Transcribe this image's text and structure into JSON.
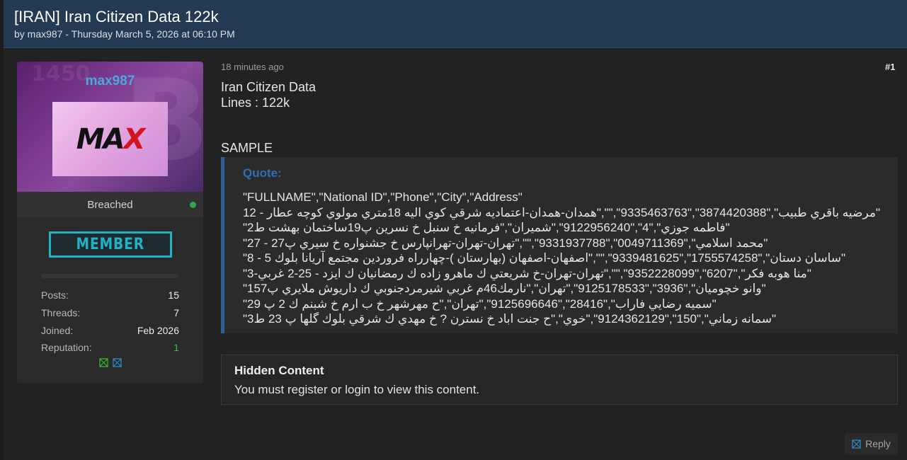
{
  "thread": {
    "title": "[IRAN] Iran Citizen Data 122k",
    "meta": "by max987 - Thursday March 5, 2026 at 06:10 PM"
  },
  "user": {
    "username": "max987",
    "avatar_text": "MA",
    "avatar_text_x": "X",
    "role": "Breached",
    "badge": "MEMBER",
    "stats": [
      {
        "label": "Posts:",
        "value": "15"
      },
      {
        "label": "Threads:",
        "value": "7"
      },
      {
        "label": "Joined:",
        "value": "Feb 2026"
      },
      {
        "label": "Reputation:",
        "value": "1"
      }
    ]
  },
  "post": {
    "time": "18 minutes ago",
    "number": "#1",
    "lines": [
      "Iran Citizen Data",
      "Lines : 122k",
      "SAMPLE"
    ],
    "quote_label": "Quote:",
    "quote_header": "\"FULLNAME\",\"National ID\",\"Phone\",\"City\",\"Address\"",
    "quote_rows": [
      "\"مرضيه باقري طبيب\",\"3874420388\",\"9335463763\",\"\",\"همدان-همدان-اعتماديه شرقي كوي اليه 18متري مولوي كوچه عطار - 12\"",
      "\"فاطمه جوزي\",\"4\",\"9122956240\",\"شميران\",\"فرمانيه خ سنبل خ نسرين پ19ساختمان بهشت ط2\"",
      "\"محمد اسلامي\",\"0049711369\",\"9331937788\",\"\",\"تهران-تهران-تهرانپارس خ جشنواره خ سيري پ27 - 27\"",
      "\"ساسان دستان\",\"1755574258\",\"9339481625\",\"\",\"اصفهان-اصفهان (بهارستان )-چهارراه فروردين مجتمع آريانا بلوك 5 - 8\"",
      "\"منا هوبه فكر\",\"6207\",\"9352228099\",\"\",\"تهران-تهران-خ شريعتي ك ماهرو زاده ك رمضانيان ك  ايزد  -  25-2 غربي-3\"",
      "\"وانو خچوميان\",\"3936\",\"9125178533\",\"تهران\",\"نارمك46م غربي شيرمردجنوبي ك داريوش ملايري پ157\"",
      "\"سميه رضايي فاراب\",\"28416\",\"9125696646\",\"تهران\",\"ح مهرشهر خ ب ارم خ شبنم ك 2 پ 29\"",
      "\"سمانه زماني\",\"150\",\"9124362129\",\"خوي\",\"ح جنت اباد خ نسترن ? خ مهدي ك شرقي بلوك گلها پ 23 ط3\""
    ],
    "hidden_title": "Hidden Content",
    "hidden_text": "You must register or login to view this content."
  },
  "actions": {
    "reply_label": "Reply",
    "reply_icon": "reply-icon"
  },
  "colors": {
    "header_bg": "#243a52",
    "username": "#4aa8e0",
    "member_badge": "#1fb3c4",
    "quote_accent": "#2e5f96",
    "online": "#2fa84f",
    "reputation": "#3cbf3c"
  }
}
